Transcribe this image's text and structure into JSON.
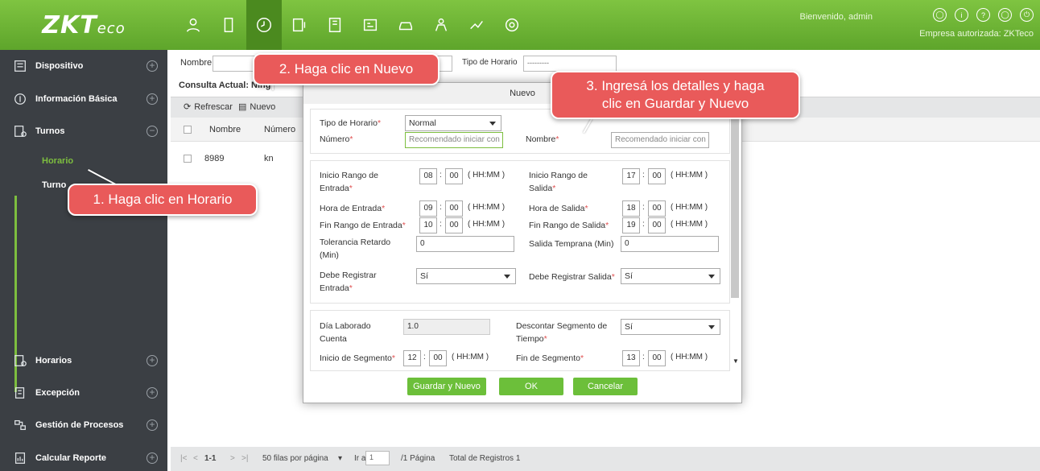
{
  "brand": {
    "logo": "ZKT",
    "logo_suffix": "eco"
  },
  "top_nav": {
    "icons": [
      "user-icon",
      "door-icon",
      "clock-icon",
      "attendance-icon",
      "building-icon",
      "visitor-icon",
      "car-icon",
      "patrol-icon",
      "signature-icon",
      "gear-icon"
    ],
    "active_index": 2
  },
  "header": {
    "welcome": "Bienvenido, admin",
    "company": "Empresa autorizada: ZKTeco",
    "right_icons": [
      "user-circle-icon",
      "info-icon",
      "help-icon",
      "account-icon",
      "power-icon"
    ]
  },
  "sidebar": {
    "items": [
      {
        "label": "Dispositivo",
        "icon": "device-icon",
        "state": "+"
      },
      {
        "label": "Información Básica",
        "icon": "info-gear-icon",
        "state": "+"
      },
      {
        "label": "Turnos",
        "icon": "shifts-icon",
        "state": "−"
      },
      {
        "label": "Horarios",
        "icon": "schedules-icon",
        "state": "+"
      },
      {
        "label": "Excepción",
        "icon": "exception-icon",
        "state": "+"
      },
      {
        "label": "Gestión de Procesos",
        "icon": "process-icon",
        "state": "+"
      },
      {
        "label": "Calcular Reporte",
        "icon": "report-icon",
        "state": "+"
      }
    ],
    "sub_items": [
      {
        "label": "Horario",
        "active": true
      },
      {
        "label": "Turno",
        "active": false
      }
    ]
  },
  "search": {
    "name_label": "Nombre",
    "type_label": "Tipo de Horario",
    "type_value": "---------"
  },
  "consulta": "Consulta Actual: Ning",
  "toolbar": {
    "refresh": "Refrescar",
    "new": "Nuevo"
  },
  "grid": {
    "columns": [
      "Nombre",
      "Número"
    ],
    "rows": [
      {
        "name": "8989",
        "number": "kn"
      }
    ]
  },
  "footer": {
    "range": "1-1",
    "per_page": "50 filas por página",
    "go_to": "Ir a",
    "page_value": "1",
    "pages": "/1 Página",
    "total": "Total de Registros 1"
  },
  "modal": {
    "title": "Nuevo",
    "tipo_label": "Tipo de Horario",
    "tipo_value": "Normal",
    "numero_label": "Número",
    "numero_placeholder": "Recomendado iniciar con '",
    "nombre_label": "Nombre",
    "nombre_placeholder": "Recomendado iniciar con '",
    "inicio_entrada_label": "Inicio Rango de Entrada",
    "inicio_entrada": [
      "08",
      "00"
    ],
    "inicio_salida_label": "Inicio Rango de Salida",
    "inicio_salida": [
      "17",
      "00"
    ],
    "hora_entrada_label": "Hora de Entrada",
    "hora_entrada": [
      "09",
      "00"
    ],
    "hora_salida_label": "Hora de Salida",
    "hora_salida": [
      "18",
      "00"
    ],
    "fin_entrada_label": "Fin Rango de Entrada",
    "fin_entrada": [
      "10",
      "00"
    ],
    "fin_salida_label": "Fin Rango de Salida",
    "fin_salida": [
      "19",
      "00"
    ],
    "hhmm": "( HH:MM )",
    "tolerancia_label": "Tolerancia Retardo (Min)",
    "tolerancia_value": "0",
    "temprana_label": "Salida Temprana (Min)",
    "temprana_value": "0",
    "debe_entrada_label": "Debe Registrar Entrada",
    "debe_entrada_value": "Sí",
    "debe_salida_label": "Debe Registrar Salida",
    "debe_salida_value": "Sí",
    "dia_label": "Día Laborado Cuenta",
    "dia_value": "1.0",
    "descontar_label": "Descontar Segmento de Tiempo",
    "descontar_value": "Sí",
    "inicio_segmento_label": "Inicio de Segmento",
    "inicio_segmento": [
      "12",
      "00"
    ],
    "fin_segmento_label": "Fin de Segmento",
    "fin_segmento": [
      "13",
      "00"
    ],
    "btn_save_new": "Guardar y Nuevo",
    "btn_ok": "OK",
    "btn_cancel": "Cancelar"
  },
  "callouts": {
    "c1": "1. Haga clic en Horario",
    "c2": "2. Haga clic en Nuevo",
    "c3_line1": "3. Ingresá los detalles  y haga",
    "c3_line2": "clic en Guardar y Nuevo"
  },
  "colors": {
    "brand_green": "#6cbf3a",
    "sidebar": "#3b3f44",
    "callout": "#e95a5a"
  }
}
